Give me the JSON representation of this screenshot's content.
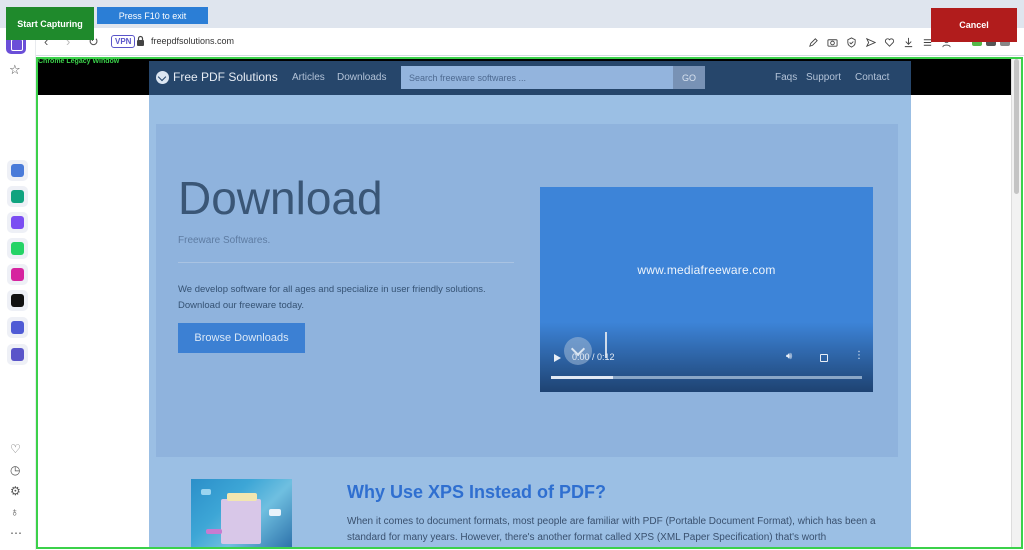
{
  "overlay": {
    "start_label": "Start Capturing",
    "f10_label": "Press F10 to exit",
    "cancel_label": "Cancel",
    "capture_label": "Chrome Legacy Window"
  },
  "browser": {
    "vpn_label": "VPN",
    "url": "freepdfsolutions.com",
    "toolbar_icons": [
      "edit-icon",
      "camera-icon",
      "shield-check-icon",
      "send-icon",
      "heart-icon",
      "download-icon",
      "list-icon",
      "profile-icon"
    ]
  },
  "sidebar": {
    "apps": [
      {
        "name": "aria-app",
        "color": "#4a7bd9"
      },
      {
        "name": "chatgpt-app",
        "color": "#10a37f"
      },
      {
        "name": "messenger-app",
        "color": "#7b4df2"
      },
      {
        "name": "whatsapp-app",
        "color": "#25d366"
      },
      {
        "name": "instagram-app",
        "color": "#d6249f"
      },
      {
        "name": "x-app",
        "color": "#111111"
      },
      {
        "name": "music-app",
        "color": "#4f5bd5"
      },
      {
        "name": "player-app",
        "color": "#5a55c9"
      }
    ]
  },
  "site": {
    "brand": "Free PDF Solutions",
    "nav": {
      "articles": "Articles",
      "downloads": "Downloads",
      "faqs": "Faqs",
      "support": "Support",
      "contact": "Contact"
    },
    "search_placeholder": "Search freeware softwares ...",
    "go_label": "GO",
    "hero": {
      "title": "Download",
      "subtitle": "Freeware Softwares.",
      "text": "We develop software for all ages and specialize in user friendly solutions. Download our freeware today.",
      "button": "Browse Downloads"
    },
    "video": {
      "watermark": "www.mediafreeware.com",
      "time": "0:00 / 0:12",
      "progress": 0.2
    },
    "section": {
      "title": "Why Use XPS Instead of PDF?",
      "text": "When it comes to document formats, most people are familiar with PDF (Portable Document Format), which has been a standard for many years. However, there's another format called XPS (XML Paper Specification) that's worth"
    }
  }
}
